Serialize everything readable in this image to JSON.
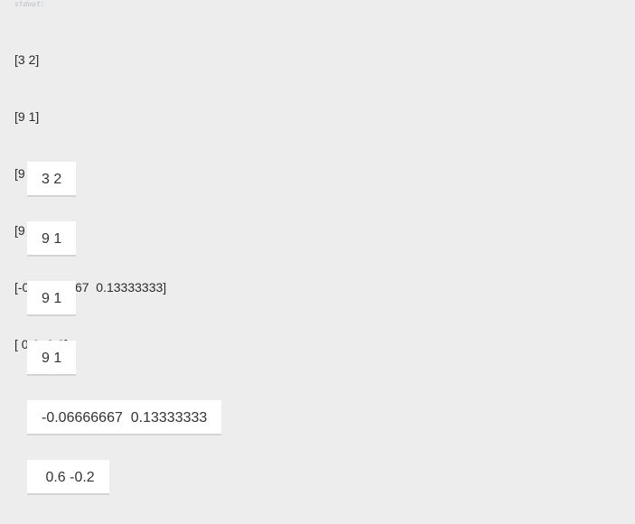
{
  "stdout": {
    "label": "stdout:",
    "lines": [
      "[3 2]",
      "[9 1]",
      "[9 1]",
      "[9 1]",
      "[-0.06666667  0.13333333]",
      "[ 0.6 -0.2]"
    ]
  },
  "outputs": [
    "3 2",
    "9 1",
    "9 1",
    "9 1",
    "-0.06666667  0.13333333",
    " 0.6 -0.2"
  ]
}
